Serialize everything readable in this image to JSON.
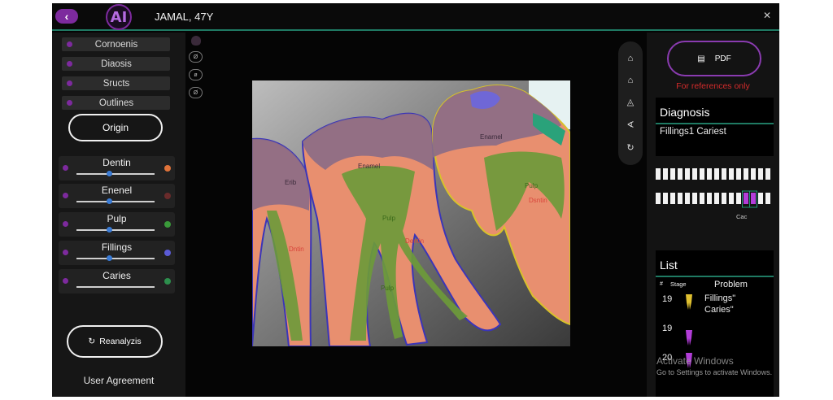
{
  "header": {
    "back_icon": "chevron-left-icon",
    "logo_text": "AI",
    "patient": "JAMAL, 47Y",
    "close_icon": "close-icon"
  },
  "sidebar": {
    "layers": [
      {
        "label": "Cornoenis"
      },
      {
        "label": "Diaosis"
      },
      {
        "label": "Sructs"
      },
      {
        "label": "Outlines"
      }
    ],
    "origin_label": "Origin",
    "sliders": [
      {
        "label": "Dentin",
        "level": 0.42,
        "color": "#e0733a"
      },
      {
        "label": "Enenel",
        "level": 0.42,
        "color": "#6a2b2b"
      },
      {
        "label": "Pulp",
        "level": 0.42,
        "color": "#3a9a3a"
      },
      {
        "label": "Fillings",
        "level": 0.42,
        "color": "#5b5bd6"
      },
      {
        "label": "Caries",
        "level": null,
        "color": "#2d8f4d"
      }
    ],
    "reanalyze_label": "Reanalyzis",
    "reanalyze_icon": "refresh-icon",
    "user_agreement": "User Agreement"
  },
  "mini_tools": [
    "tooth-icon",
    "Ø",
    "ø",
    "Ø"
  ],
  "xray": {
    "labels": [
      "Enarnel",
      "Enamel",
      "Dntin",
      "Dsntin",
      "Pulp",
      "Pulp",
      "Pulp",
      "Dentin",
      "Erib",
      "Enamel"
    ]
  },
  "tools": {
    "icons": [
      "home-icon",
      "house-icon",
      "triangle-icon",
      "angle-icon",
      "refresh-icon"
    ]
  },
  "right": {
    "pdf_label": "PDF",
    "pdf_icon": "document-icon",
    "ref_note": "For references only",
    "diagnosis_title": "Diagnosis",
    "diagnosis_text": "Fillings1 Cariest",
    "chart_label": "Cac",
    "list_title": "List",
    "list_headers": {
      "num": "#",
      "stage": "Stage",
      "problem": "Problem"
    },
    "rows": [
      {
        "num": "19",
        "problems": [
          "Fillings\"",
          "Caries\""
        ],
        "tooth_color": "#e0c030"
      },
      {
        "num": "19",
        "problems": [],
        "tooth_color": "#b23dd8"
      },
      {
        "num": "20",
        "problems": [],
        "tooth_color": "#b23dd8"
      }
    ],
    "watermark": "Activate Windows",
    "watermark_sub": "Go to Settings to activate Windows."
  }
}
